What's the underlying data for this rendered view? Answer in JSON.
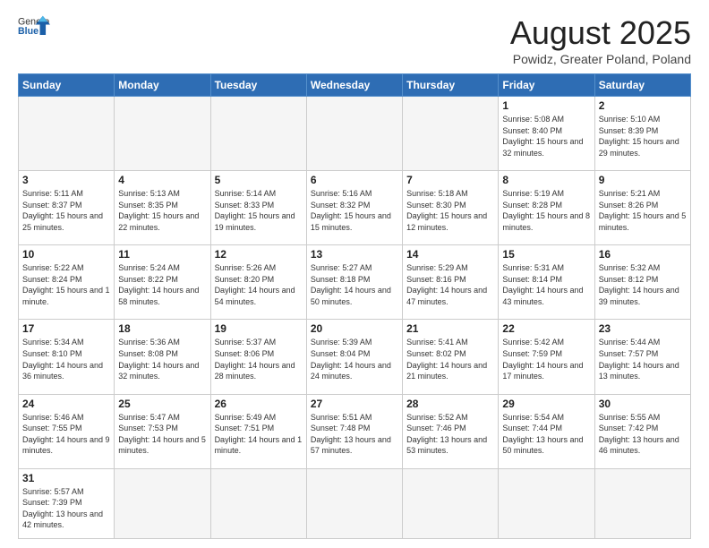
{
  "header": {
    "logo_general": "General",
    "logo_blue": "Blue",
    "title": "August 2025",
    "subtitle": "Powidz, Greater Poland, Poland"
  },
  "weekdays": [
    "Sunday",
    "Monday",
    "Tuesday",
    "Wednesday",
    "Thursday",
    "Friday",
    "Saturday"
  ],
  "weeks": [
    [
      {
        "day": "",
        "info": "",
        "empty": true
      },
      {
        "day": "",
        "info": "",
        "empty": true
      },
      {
        "day": "",
        "info": "",
        "empty": true
      },
      {
        "day": "",
        "info": "",
        "empty": true
      },
      {
        "day": "",
        "info": "",
        "empty": true
      },
      {
        "day": "1",
        "info": "Sunrise: 5:08 AM\nSunset: 8:40 PM\nDaylight: 15 hours and 32 minutes."
      },
      {
        "day": "2",
        "info": "Sunrise: 5:10 AM\nSunset: 8:39 PM\nDaylight: 15 hours and 29 minutes."
      }
    ],
    [
      {
        "day": "3",
        "info": "Sunrise: 5:11 AM\nSunset: 8:37 PM\nDaylight: 15 hours and 25 minutes."
      },
      {
        "day": "4",
        "info": "Sunrise: 5:13 AM\nSunset: 8:35 PM\nDaylight: 15 hours and 22 minutes."
      },
      {
        "day": "5",
        "info": "Sunrise: 5:14 AM\nSunset: 8:33 PM\nDaylight: 15 hours and 19 minutes."
      },
      {
        "day": "6",
        "info": "Sunrise: 5:16 AM\nSunset: 8:32 PM\nDaylight: 15 hours and 15 minutes."
      },
      {
        "day": "7",
        "info": "Sunrise: 5:18 AM\nSunset: 8:30 PM\nDaylight: 15 hours and 12 minutes."
      },
      {
        "day": "8",
        "info": "Sunrise: 5:19 AM\nSunset: 8:28 PM\nDaylight: 15 hours and 8 minutes."
      },
      {
        "day": "9",
        "info": "Sunrise: 5:21 AM\nSunset: 8:26 PM\nDaylight: 15 hours and 5 minutes."
      }
    ],
    [
      {
        "day": "10",
        "info": "Sunrise: 5:22 AM\nSunset: 8:24 PM\nDaylight: 15 hours and 1 minute."
      },
      {
        "day": "11",
        "info": "Sunrise: 5:24 AM\nSunset: 8:22 PM\nDaylight: 14 hours and 58 minutes."
      },
      {
        "day": "12",
        "info": "Sunrise: 5:26 AM\nSunset: 8:20 PM\nDaylight: 14 hours and 54 minutes."
      },
      {
        "day": "13",
        "info": "Sunrise: 5:27 AM\nSunset: 8:18 PM\nDaylight: 14 hours and 50 minutes."
      },
      {
        "day": "14",
        "info": "Sunrise: 5:29 AM\nSunset: 8:16 PM\nDaylight: 14 hours and 47 minutes."
      },
      {
        "day": "15",
        "info": "Sunrise: 5:31 AM\nSunset: 8:14 PM\nDaylight: 14 hours and 43 minutes."
      },
      {
        "day": "16",
        "info": "Sunrise: 5:32 AM\nSunset: 8:12 PM\nDaylight: 14 hours and 39 minutes."
      }
    ],
    [
      {
        "day": "17",
        "info": "Sunrise: 5:34 AM\nSunset: 8:10 PM\nDaylight: 14 hours and 36 minutes."
      },
      {
        "day": "18",
        "info": "Sunrise: 5:36 AM\nSunset: 8:08 PM\nDaylight: 14 hours and 32 minutes."
      },
      {
        "day": "19",
        "info": "Sunrise: 5:37 AM\nSunset: 8:06 PM\nDaylight: 14 hours and 28 minutes."
      },
      {
        "day": "20",
        "info": "Sunrise: 5:39 AM\nSunset: 8:04 PM\nDaylight: 14 hours and 24 minutes."
      },
      {
        "day": "21",
        "info": "Sunrise: 5:41 AM\nSunset: 8:02 PM\nDaylight: 14 hours and 21 minutes."
      },
      {
        "day": "22",
        "info": "Sunrise: 5:42 AM\nSunset: 7:59 PM\nDaylight: 14 hours and 17 minutes."
      },
      {
        "day": "23",
        "info": "Sunrise: 5:44 AM\nSunset: 7:57 PM\nDaylight: 14 hours and 13 minutes."
      }
    ],
    [
      {
        "day": "24",
        "info": "Sunrise: 5:46 AM\nSunset: 7:55 PM\nDaylight: 14 hours and 9 minutes."
      },
      {
        "day": "25",
        "info": "Sunrise: 5:47 AM\nSunset: 7:53 PM\nDaylight: 14 hours and 5 minutes."
      },
      {
        "day": "26",
        "info": "Sunrise: 5:49 AM\nSunset: 7:51 PM\nDaylight: 14 hours and 1 minute."
      },
      {
        "day": "27",
        "info": "Sunrise: 5:51 AM\nSunset: 7:48 PM\nDaylight: 13 hours and 57 minutes."
      },
      {
        "day": "28",
        "info": "Sunrise: 5:52 AM\nSunset: 7:46 PM\nDaylight: 13 hours and 53 minutes."
      },
      {
        "day": "29",
        "info": "Sunrise: 5:54 AM\nSunset: 7:44 PM\nDaylight: 13 hours and 50 minutes."
      },
      {
        "day": "30",
        "info": "Sunrise: 5:55 AM\nSunset: 7:42 PM\nDaylight: 13 hours and 46 minutes."
      }
    ],
    [
      {
        "day": "31",
        "info": "Sunrise: 5:57 AM\nSunset: 7:39 PM\nDaylight: 13 hours and 42 minutes.",
        "last": true
      },
      {
        "day": "",
        "info": "",
        "empty": true,
        "last": true
      },
      {
        "day": "",
        "info": "",
        "empty": true,
        "last": true
      },
      {
        "day": "",
        "info": "",
        "empty": true,
        "last": true
      },
      {
        "day": "",
        "info": "",
        "empty": true,
        "last": true
      },
      {
        "day": "",
        "info": "",
        "empty": true,
        "last": true
      },
      {
        "day": "",
        "info": "",
        "empty": true,
        "last": true
      }
    ]
  ]
}
